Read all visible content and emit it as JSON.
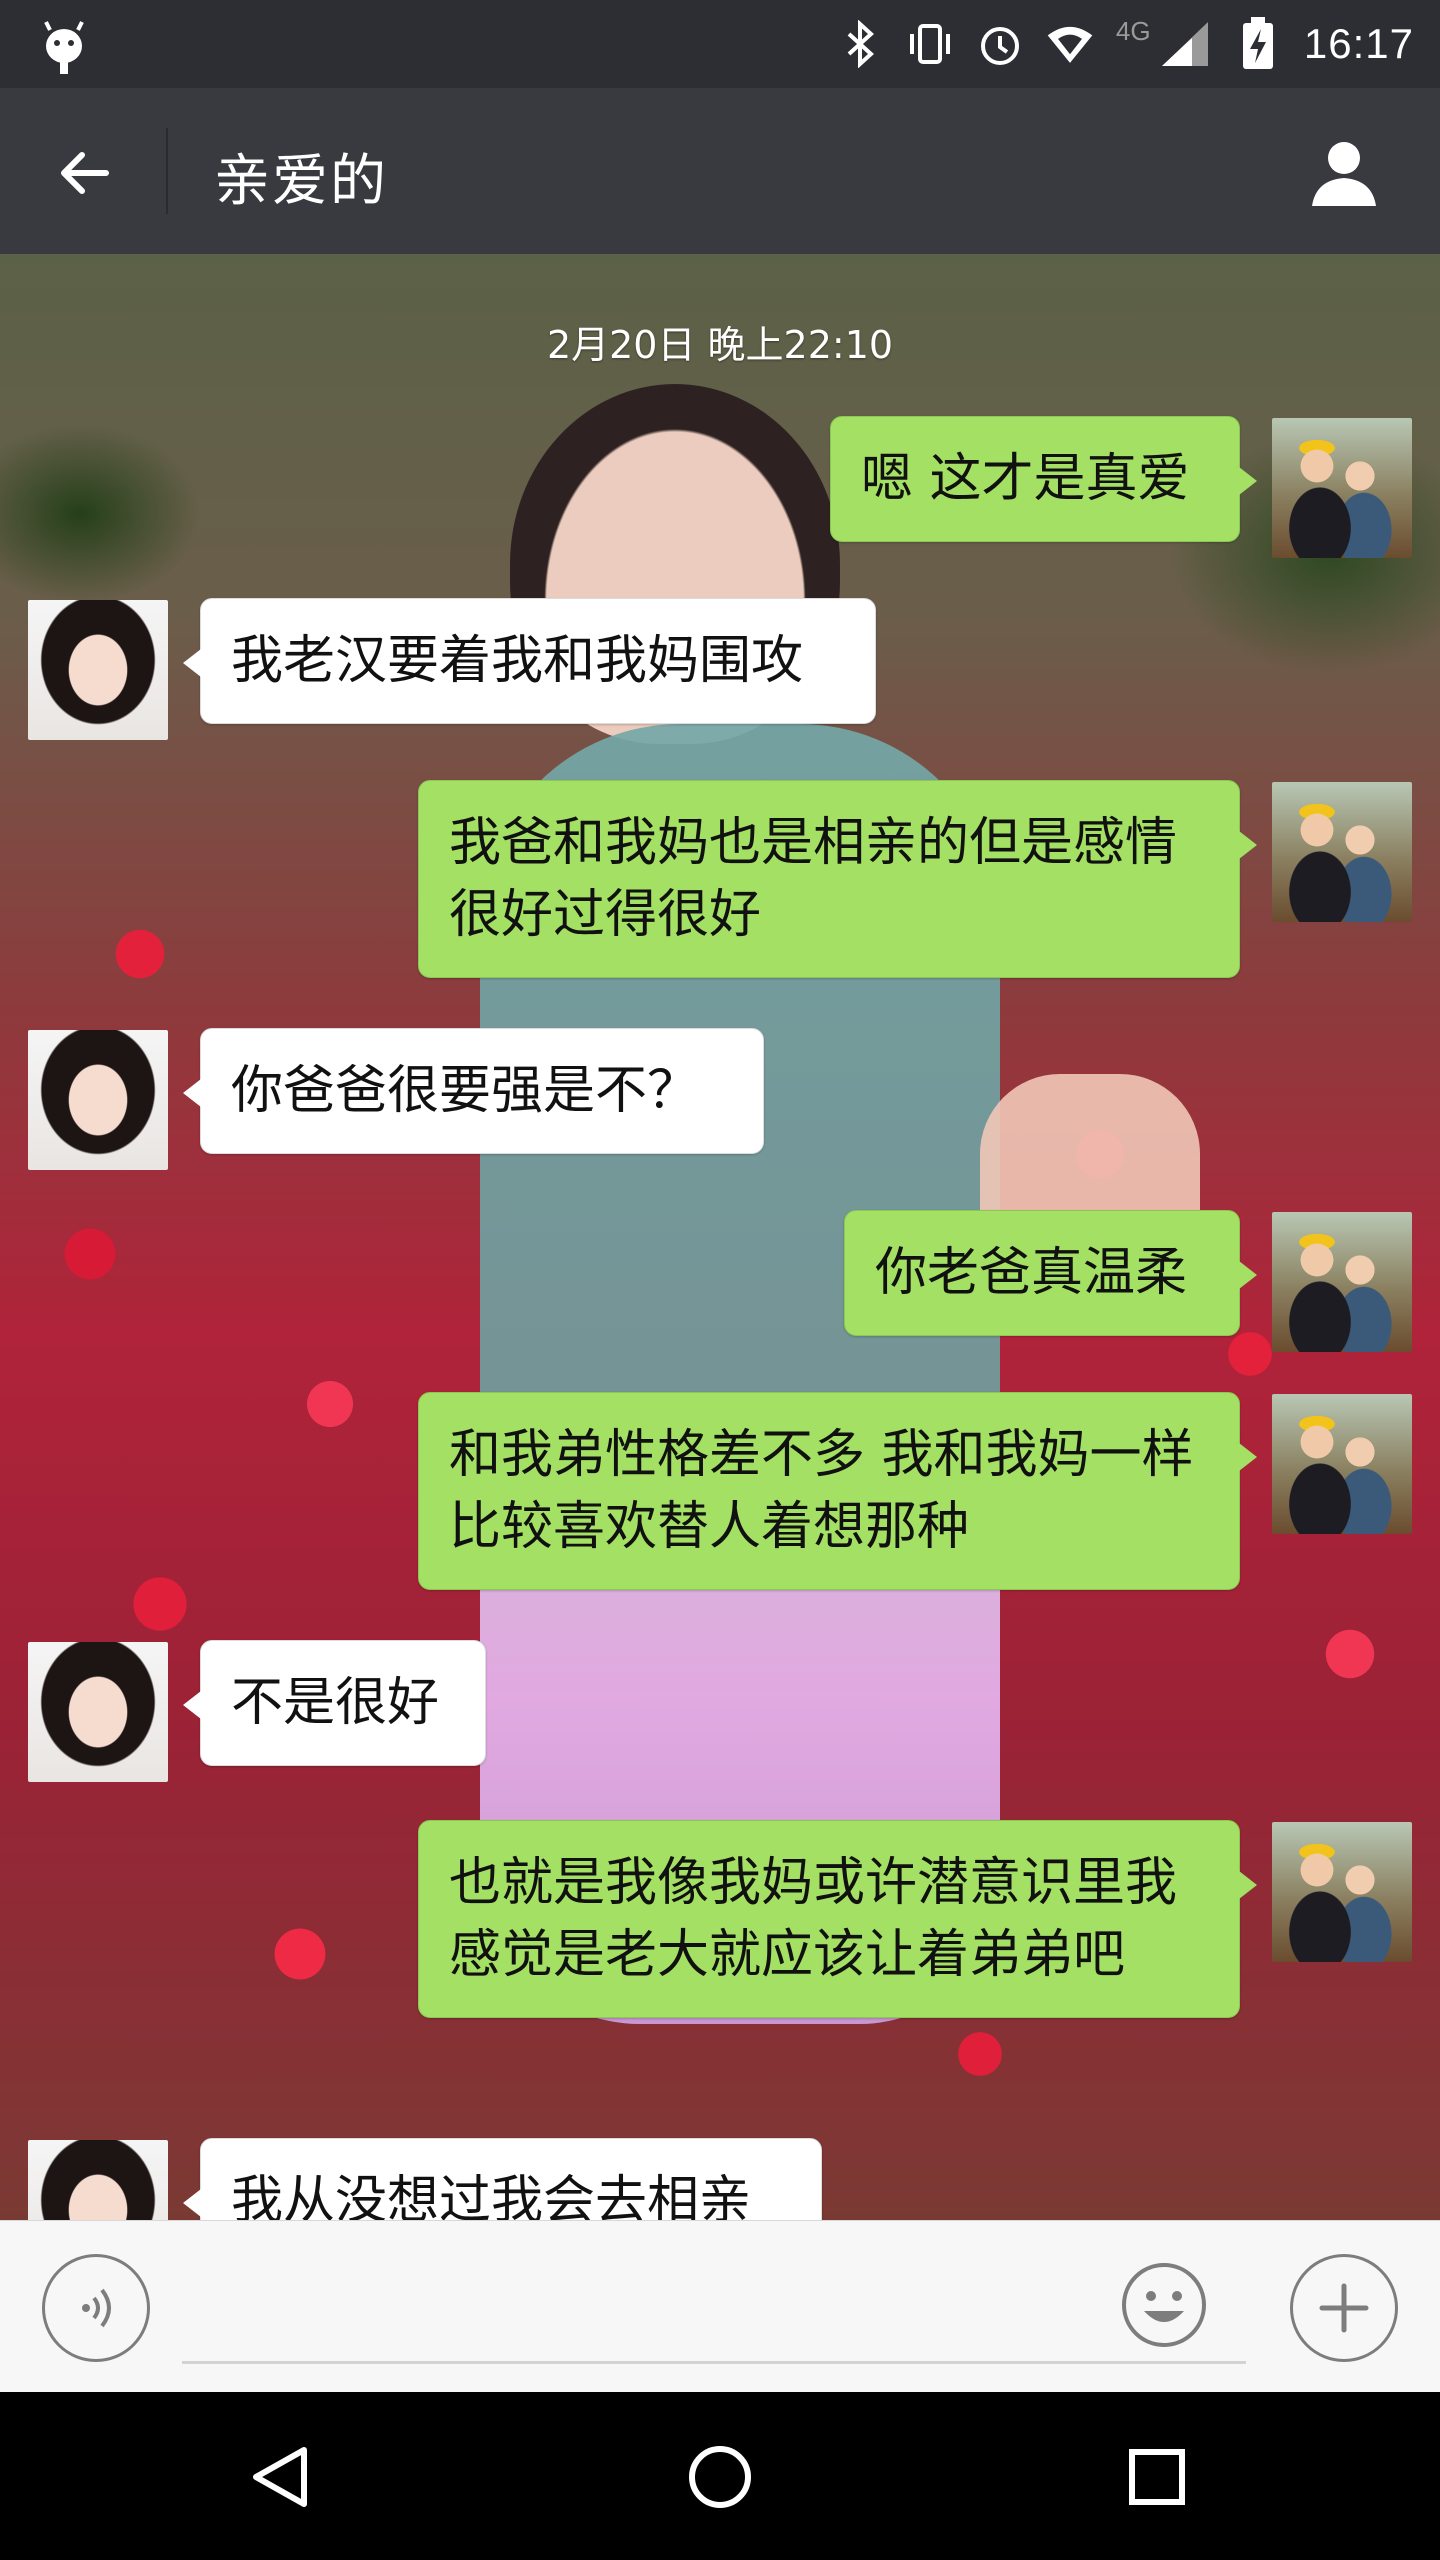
{
  "status_bar": {
    "time": "16:17",
    "network_label": "4G",
    "icons": [
      "android-icon",
      "bluetooth-icon",
      "vibrate-icon",
      "alarm-icon",
      "wifi-icon",
      "signal-icon",
      "battery-charging-icon"
    ]
  },
  "app_bar": {
    "title": "亲爱的",
    "back_icon": "back-arrow-icon",
    "profile_icon": "person-icon"
  },
  "chat": {
    "timestamp": "2月20日 晚上22:10",
    "messages": [
      {
        "side": "right",
        "text": "嗯 这才是真爱"
      },
      {
        "side": "left",
        "text": "我老汉要着我和我妈围攻"
      },
      {
        "side": "right",
        "text": "我爸和我妈也是相亲的但是感情很好过得很好"
      },
      {
        "side": "left",
        "text": "你爸爸很要强是不？"
      },
      {
        "side": "right",
        "text": "你老爸真温柔"
      },
      {
        "side": "right",
        "text": "和我弟性格差不多 我和我妈一样比较喜欢替人着想那种"
      },
      {
        "side": "left",
        "text": "不是很好"
      },
      {
        "side": "right",
        "text": "也就是我像我妈或许潜意识里我感觉是老大就应该让着弟弟吧"
      },
      {
        "side": "left",
        "text": "我从没想过我会去相亲"
      }
    ]
  },
  "input_bar": {
    "placeholder": "",
    "voice_icon": "voice-icon",
    "emoji_icon": "emoji-icon",
    "plus_icon": "plus-icon"
  },
  "nav_bar": {
    "icons": [
      "nav-back-icon",
      "nav-home-icon",
      "nav-recents-icon"
    ]
  },
  "colors": {
    "status_bar": "#2c2e33",
    "app_bar": "#393a3f",
    "sent_bubble": "#a3e063",
    "received_bubble": "#ffffff",
    "input_bar": "#f7f7f7",
    "nav_bar": "#000000"
  }
}
